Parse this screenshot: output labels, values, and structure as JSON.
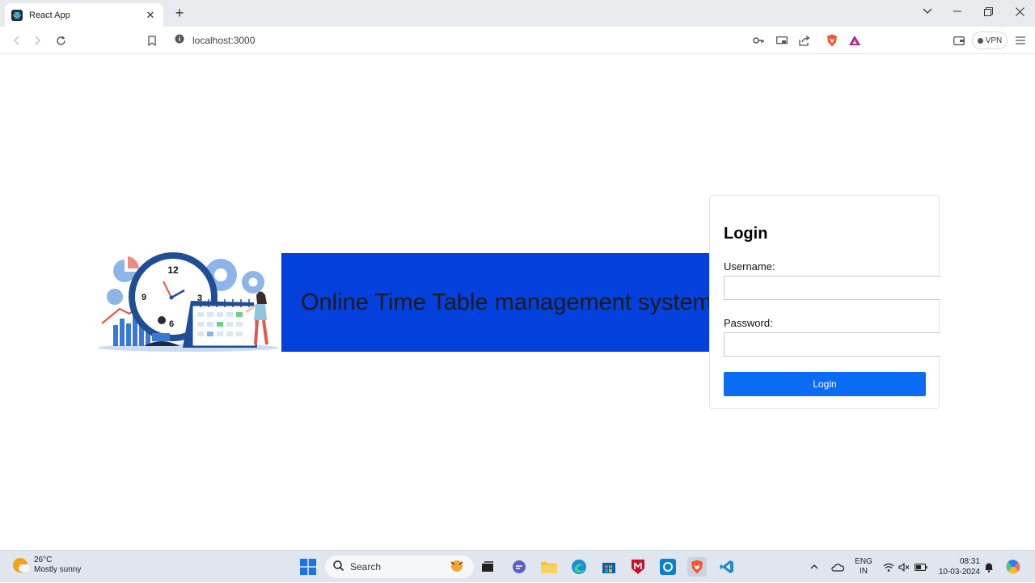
{
  "browser": {
    "tab_title": "React App",
    "url": "localhost:3000",
    "vpn_label": "VPN"
  },
  "page": {
    "banner_title": "Online Time Table management system",
    "login": {
      "heading": "Login",
      "username_label": "Username:",
      "username_value": "",
      "password_label": "Password:",
      "password_value": "",
      "submit_label": "Login"
    },
    "illustration": {
      "clock_numbers": [
        "12",
        "3",
        "6",
        "9"
      ]
    }
  },
  "taskbar": {
    "weather_temp": "26°C",
    "weather_desc": "Mostly sunny",
    "search_placeholder": "Search",
    "lang_line1": "ENG",
    "lang_line2": "IN",
    "time": "08:31",
    "date": "10-03-2024"
  },
  "colors": {
    "banner": "#0340dc",
    "button": "#0a6cf5",
    "taskbar": "#dfe6ee"
  }
}
